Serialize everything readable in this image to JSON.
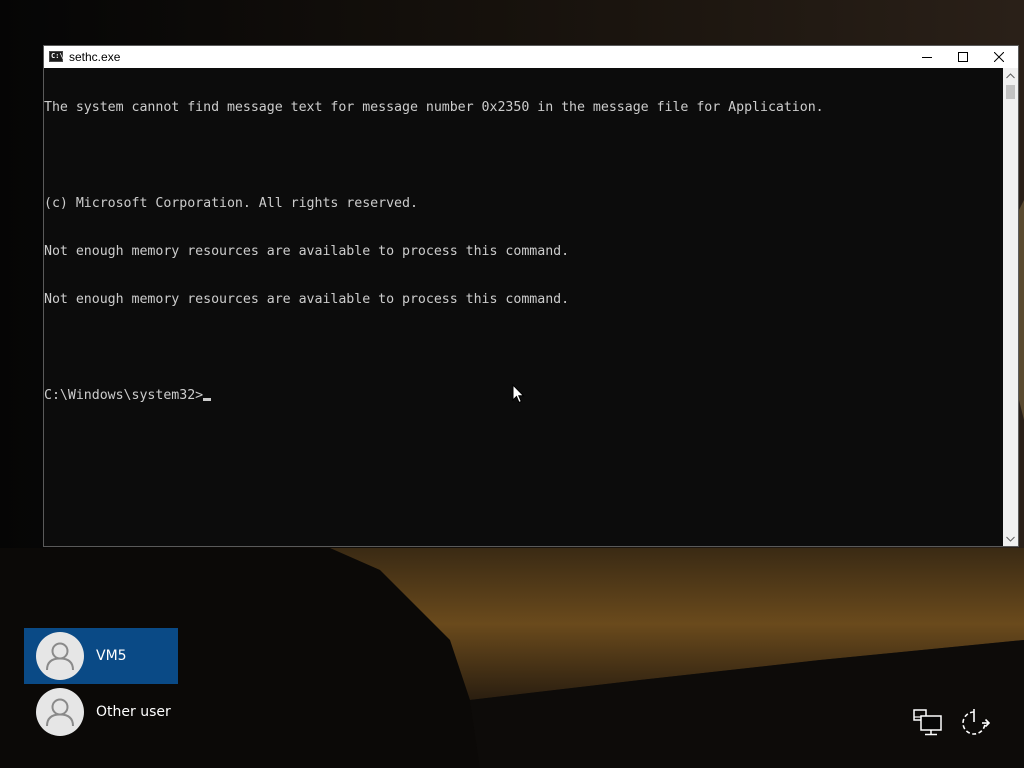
{
  "window": {
    "title": "sethc.exe",
    "icon": "cmd-icon",
    "icon_glyph": "C:\\"
  },
  "console": {
    "lines": [
      "The system cannot find message text for message number 0x2350 in the message file for Application.",
      "",
      "(c) Microsoft Corporation. All rights reserved.",
      "Not enough memory resources are available to process this command.",
      "Not enough memory resources are available to process this command.",
      ""
    ],
    "prompt": "C:\\Windows\\system32>"
  },
  "users": [
    {
      "name": "VM5",
      "selected": true
    },
    {
      "name": "Other user",
      "selected": false
    }
  ],
  "icons": {
    "network": "network-icon",
    "power": "power-icon"
  },
  "colors": {
    "console_bg": "#0c0c0c",
    "console_fg": "#cccccc",
    "selected_user_bg": "#0a4a86"
  }
}
